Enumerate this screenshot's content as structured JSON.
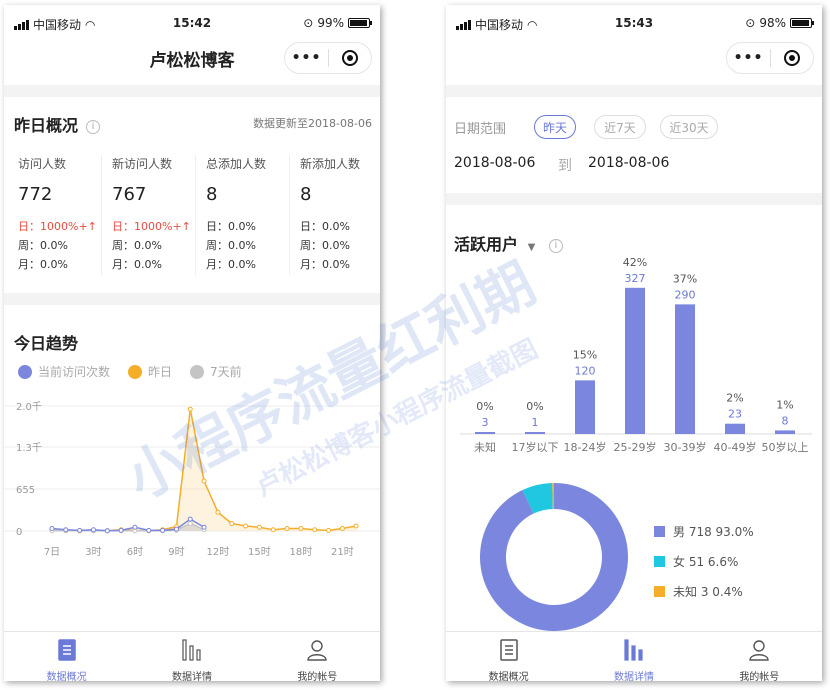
{
  "left": {
    "status": {
      "carrier": "中国移动",
      "time": "15:42",
      "battery": "99%"
    },
    "nav_title": "卢松松博客",
    "overview": {
      "title": "昨日概况",
      "updated": "数据更新至2018-08-06",
      "stats": [
        {
          "label": "访问人数",
          "value": "772",
          "day": "日：1000%+↑",
          "week": "周：0.0%",
          "month": "月：0.0%",
          "day_up": true
        },
        {
          "label": "新访问人数",
          "value": "767",
          "day": "日：1000%+↑",
          "week": "周：0.0%",
          "month": "月：0.0%",
          "day_up": true
        },
        {
          "label": "总添加人数",
          "value": "8",
          "day": "日：0.0%",
          "week": "周：0.0%",
          "month": "月：0.0%",
          "day_up": false
        },
        {
          "label": "新添加人数",
          "value": "8",
          "day": "日：0.0%",
          "week": "周：0.0%",
          "month": "月：0.0%",
          "day_up": false
        }
      ]
    },
    "trend": {
      "title": "今日趋势",
      "legend": [
        {
          "name": "当前访问次数",
          "color": "#7b87de"
        },
        {
          "name": "昨日",
          "color": "#f5ae2a"
        },
        {
          "name": "7天前",
          "color": "#c4c4c4"
        }
      ]
    },
    "tabs": [
      {
        "label": "数据概况",
        "icon": "list-icon",
        "active": true
      },
      {
        "label": "数据详情",
        "icon": "bar-chart-icon",
        "active": false
      },
      {
        "label": "我的帐号",
        "icon": "user-icon",
        "active": false
      }
    ]
  },
  "right": {
    "status": {
      "carrier": "中国移动",
      "time": "15:43",
      "battery": "98%"
    },
    "range": {
      "label": "日期范围",
      "options": [
        "昨天",
        "近7天",
        "近30天"
      ],
      "selected": 0
    },
    "dates": {
      "start": "2018-08-06",
      "to": "到",
      "end": "2018-08-06"
    },
    "active_title": "活跃用户",
    "tabs": [
      {
        "label": "数据概况",
        "icon": "list-icon",
        "active": false
      },
      {
        "label": "数据详情",
        "icon": "bar-chart-icon",
        "active": true
      },
      {
        "label": "我的帐号",
        "icon": "user-icon",
        "active": false
      }
    ]
  },
  "chart_data": [
    {
      "type": "line",
      "x_ticks": [
        "7日",
        "3时",
        "6时",
        "9时",
        "12时",
        "15时",
        "18时",
        "21时"
      ],
      "y_ticks": [
        "2.0千",
        "1.3千",
        "655",
        "0"
      ],
      "ylim": [
        0,
        2000
      ],
      "x": [
        0,
        1,
        2,
        3,
        4,
        5,
        6,
        7,
        8,
        9,
        10,
        11,
        12,
        13,
        14,
        15,
        16,
        17,
        18,
        19,
        20,
        21,
        22,
        23
      ],
      "series": [
        {
          "name": "当前访问次数",
          "color": "#7b87de",
          "values": [
            40,
            20,
            10,
            20,
            5,
            10,
            60,
            10,
            10,
            30,
            190,
            60
          ]
        },
        {
          "name": "昨日",
          "color": "#f5ae2a",
          "values": [
            10,
            5,
            5,
            5,
            5,
            20,
            10,
            5,
            20,
            70,
            1950,
            800,
            300,
            120,
            80,
            60,
            20,
            40,
            40,
            20,
            10,
            40,
            80
          ]
        },
        {
          "name": "7天前",
          "color": "#c4c4c4",
          "values": [
            5,
            5,
            5,
            5,
            5,
            5,
            5,
            5,
            5,
            10,
            120,
            20
          ]
        }
      ]
    },
    {
      "type": "bar",
      "title": "活跃用户",
      "categories": [
        "未知",
        "17岁以下",
        "18-24岁",
        "25-29岁",
        "30-39岁",
        "40-49岁",
        "50岁以上"
      ],
      "values": [
        3,
        1,
        120,
        327,
        290,
        23,
        8
      ],
      "percents": [
        "0%",
        "0%",
        "15%",
        "42%",
        "37%",
        "2%",
        "1%"
      ],
      "ylim": [
        0,
        340
      ],
      "color": "#7b87de"
    },
    {
      "type": "pie",
      "slices": [
        {
          "name": "男",
          "value": 718,
          "percent": 93.0,
          "label": "男 718 93.0%",
          "color": "#7b87de"
        },
        {
          "name": "女",
          "value": 51,
          "percent": 6.6,
          "label": "女 51 6.6%",
          "color": "#1fc8e0"
        },
        {
          "name": "未知",
          "value": 3,
          "percent": 0.4,
          "label": "未知 3 0.4%",
          "color": "#f5ae2a"
        }
      ]
    }
  ],
  "watermark": {
    "line1": "小程序流量红利期",
    "line2": "卢松松博客小程序流量截图"
  }
}
